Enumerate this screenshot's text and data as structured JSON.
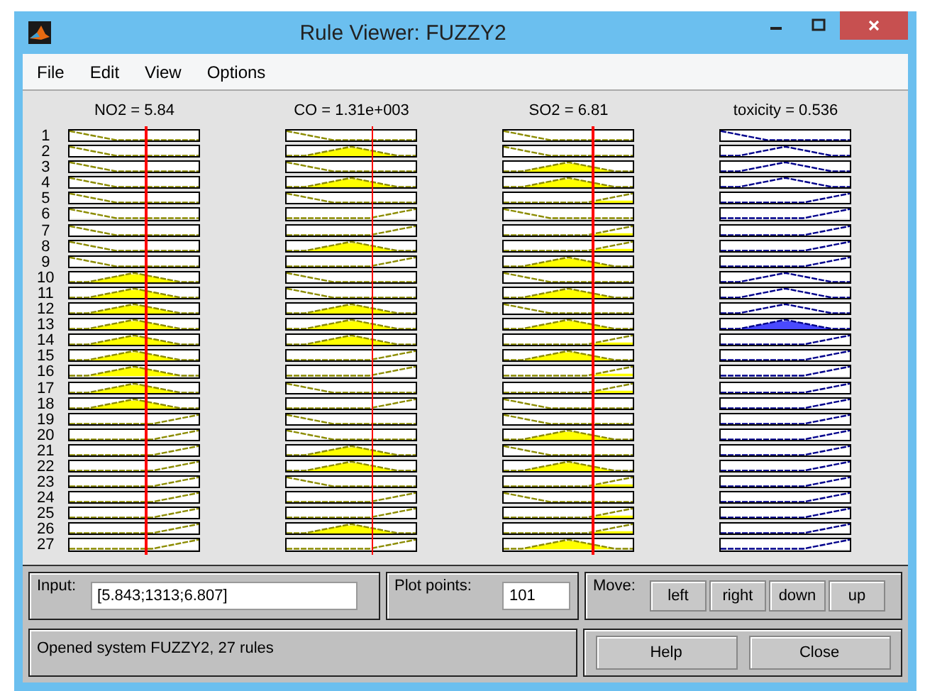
{
  "window": {
    "title": "Rule Viewer: FUZZY2"
  },
  "menu": [
    "File",
    "Edit",
    "View",
    "Options"
  ],
  "variables": [
    {
      "label": "NO2 = 5.84",
      "kind": "input",
      "level": 0.58
    },
    {
      "label": "CO = 1.31e+003",
      "kind": "input",
      "level": 0.65
    },
    {
      "label": "SO2 = 6.81",
      "kind": "input",
      "level": 0.68
    },
    {
      "label": "toxicity = 0.536",
      "kind": "output"
    }
  ],
  "rules": [
    {
      "number": "1",
      "cells": [
        {
          "kind": "low",
          "fired": false
        },
        {
          "kind": "low",
          "fired": false
        },
        {
          "kind": "low",
          "fired": false
        },
        {
          "kind": "low",
          "fired": false
        }
      ]
    },
    {
      "number": "2",
      "cells": [
        {
          "kind": "low",
          "fired": false
        },
        {
          "kind": "mid",
          "fired": true
        },
        {
          "kind": "low",
          "fired": false
        },
        {
          "kind": "mid",
          "fired": false
        }
      ]
    },
    {
      "number": "3",
      "cells": [
        {
          "kind": "low",
          "fired": false
        },
        {
          "kind": "low",
          "fired": false
        },
        {
          "kind": "mid",
          "fired": true
        },
        {
          "kind": "mid",
          "fired": false
        }
      ]
    },
    {
      "number": "4",
      "cells": [
        {
          "kind": "low",
          "fired": false
        },
        {
          "kind": "mid",
          "fired": true
        },
        {
          "kind": "mid",
          "fired": true
        },
        {
          "kind": "mid",
          "fired": false
        }
      ]
    },
    {
      "number": "5",
      "cells": [
        {
          "kind": "low",
          "fired": false
        },
        {
          "kind": "low",
          "fired": false
        },
        {
          "kind": "high",
          "fired": true
        },
        {
          "kind": "high",
          "fired": false
        }
      ]
    },
    {
      "number": "6",
      "cells": [
        {
          "kind": "low",
          "fired": false
        },
        {
          "kind": "high",
          "fired": false
        },
        {
          "kind": "low",
          "fired": false
        },
        {
          "kind": "high",
          "fired": false
        }
      ]
    },
    {
      "number": "7",
      "cells": [
        {
          "kind": "low",
          "fired": false
        },
        {
          "kind": "high",
          "fired": false
        },
        {
          "kind": "high",
          "fired": true
        },
        {
          "kind": "high",
          "fired": false
        }
      ]
    },
    {
      "number": "8",
      "cells": [
        {
          "kind": "low",
          "fired": false
        },
        {
          "kind": "mid",
          "fired": true
        },
        {
          "kind": "high",
          "fired": true
        },
        {
          "kind": "high",
          "fired": false
        }
      ]
    },
    {
      "number": "9",
      "cells": [
        {
          "kind": "low",
          "fired": false
        },
        {
          "kind": "high",
          "fired": false
        },
        {
          "kind": "mid",
          "fired": true
        },
        {
          "kind": "high",
          "fired": false
        }
      ]
    },
    {
      "number": "10",
      "cells": [
        {
          "kind": "mid",
          "fired": true
        },
        {
          "kind": "low",
          "fired": false
        },
        {
          "kind": "low",
          "fired": false
        },
        {
          "kind": "mid",
          "fired": false
        }
      ]
    },
    {
      "number": "11",
      "cells": [
        {
          "kind": "mid",
          "fired": true
        },
        {
          "kind": "low",
          "fired": false
        },
        {
          "kind": "mid",
          "fired": true
        },
        {
          "kind": "mid",
          "fired": false
        }
      ]
    },
    {
      "number": "12",
      "cells": [
        {
          "kind": "mid",
          "fired": true
        },
        {
          "kind": "mid",
          "fired": true
        },
        {
          "kind": "low",
          "fired": false
        },
        {
          "kind": "mid",
          "fired": false
        }
      ]
    },
    {
      "number": "13",
      "cells": [
        {
          "kind": "mid",
          "fired": true
        },
        {
          "kind": "mid",
          "fired": true
        },
        {
          "kind": "mid",
          "fired": true
        },
        {
          "kind": "mid",
          "fired": true
        }
      ]
    },
    {
      "number": "14",
      "cells": [
        {
          "kind": "mid",
          "fired": true
        },
        {
          "kind": "mid",
          "fired": true
        },
        {
          "kind": "high",
          "fired": true
        },
        {
          "kind": "high",
          "fired": false
        }
      ]
    },
    {
      "number": "15",
      "cells": [
        {
          "kind": "mid",
          "fired": true
        },
        {
          "kind": "high",
          "fired": false
        },
        {
          "kind": "mid",
          "fired": true
        },
        {
          "kind": "high",
          "fired": false
        }
      ]
    },
    {
      "number": "16",
      "cells": [
        {
          "kind": "mid",
          "fired": true
        },
        {
          "kind": "high",
          "fired": false
        },
        {
          "kind": "high",
          "fired": true
        },
        {
          "kind": "high",
          "fired": false
        }
      ]
    },
    {
      "number": "17",
      "cells": [
        {
          "kind": "mid",
          "fired": true
        },
        {
          "kind": "low",
          "fired": false
        },
        {
          "kind": "high",
          "fired": true
        },
        {
          "kind": "high",
          "fired": false
        }
      ]
    },
    {
      "number": "18",
      "cells": [
        {
          "kind": "mid",
          "fired": true
        },
        {
          "kind": "high",
          "fired": false
        },
        {
          "kind": "low",
          "fired": false
        },
        {
          "kind": "high",
          "fired": false
        }
      ]
    },
    {
      "number": "19",
      "cells": [
        {
          "kind": "high",
          "fired": false
        },
        {
          "kind": "low",
          "fired": false
        },
        {
          "kind": "low",
          "fired": false
        },
        {
          "kind": "high",
          "fired": false
        }
      ]
    },
    {
      "number": "20",
      "cells": [
        {
          "kind": "high",
          "fired": false
        },
        {
          "kind": "low",
          "fired": false
        },
        {
          "kind": "mid",
          "fired": true
        },
        {
          "kind": "high",
          "fired": false
        }
      ]
    },
    {
      "number": "21",
      "cells": [
        {
          "kind": "high",
          "fired": false
        },
        {
          "kind": "mid",
          "fired": true
        },
        {
          "kind": "low",
          "fired": false
        },
        {
          "kind": "high",
          "fired": false
        }
      ]
    },
    {
      "number": "22",
      "cells": [
        {
          "kind": "high",
          "fired": false
        },
        {
          "kind": "mid",
          "fired": true
        },
        {
          "kind": "mid",
          "fired": true
        },
        {
          "kind": "high",
          "fired": false
        }
      ]
    },
    {
      "number": "23",
      "cells": [
        {
          "kind": "high",
          "fired": false
        },
        {
          "kind": "low",
          "fired": false
        },
        {
          "kind": "high",
          "fired": true
        },
        {
          "kind": "high",
          "fired": false
        }
      ]
    },
    {
      "number": "24",
      "cells": [
        {
          "kind": "high",
          "fired": false
        },
        {
          "kind": "high",
          "fired": false
        },
        {
          "kind": "low",
          "fired": false
        },
        {
          "kind": "high",
          "fired": false
        }
      ]
    },
    {
      "number": "25",
      "cells": [
        {
          "kind": "high",
          "fired": false
        },
        {
          "kind": "high",
          "fired": false
        },
        {
          "kind": "high",
          "fired": true
        },
        {
          "kind": "high",
          "fired": false
        }
      ]
    },
    {
      "number": "26",
      "cells": [
        {
          "kind": "high",
          "fired": false
        },
        {
          "kind": "mid",
          "fired": true
        },
        {
          "kind": "high",
          "fired": true
        },
        {
          "kind": "high",
          "fired": false
        }
      ]
    },
    {
      "number": "27",
      "cells": [
        {
          "kind": "high",
          "fired": false
        },
        {
          "kind": "high",
          "fired": false
        },
        {
          "kind": "mid",
          "fired": true
        },
        {
          "kind": "high",
          "fired": false
        }
      ]
    }
  ],
  "input": {
    "label": "Input:",
    "value": "[5.843;1313;6.807]"
  },
  "plot_points": {
    "label": "Plot points:",
    "value": "101"
  },
  "move": {
    "label": "Move:",
    "buttons": [
      "left",
      "right",
      "down",
      "up"
    ]
  },
  "status": "Opened system FUZZY2, 27 rules",
  "buttons": [
    "Help",
    "Close"
  ]
}
